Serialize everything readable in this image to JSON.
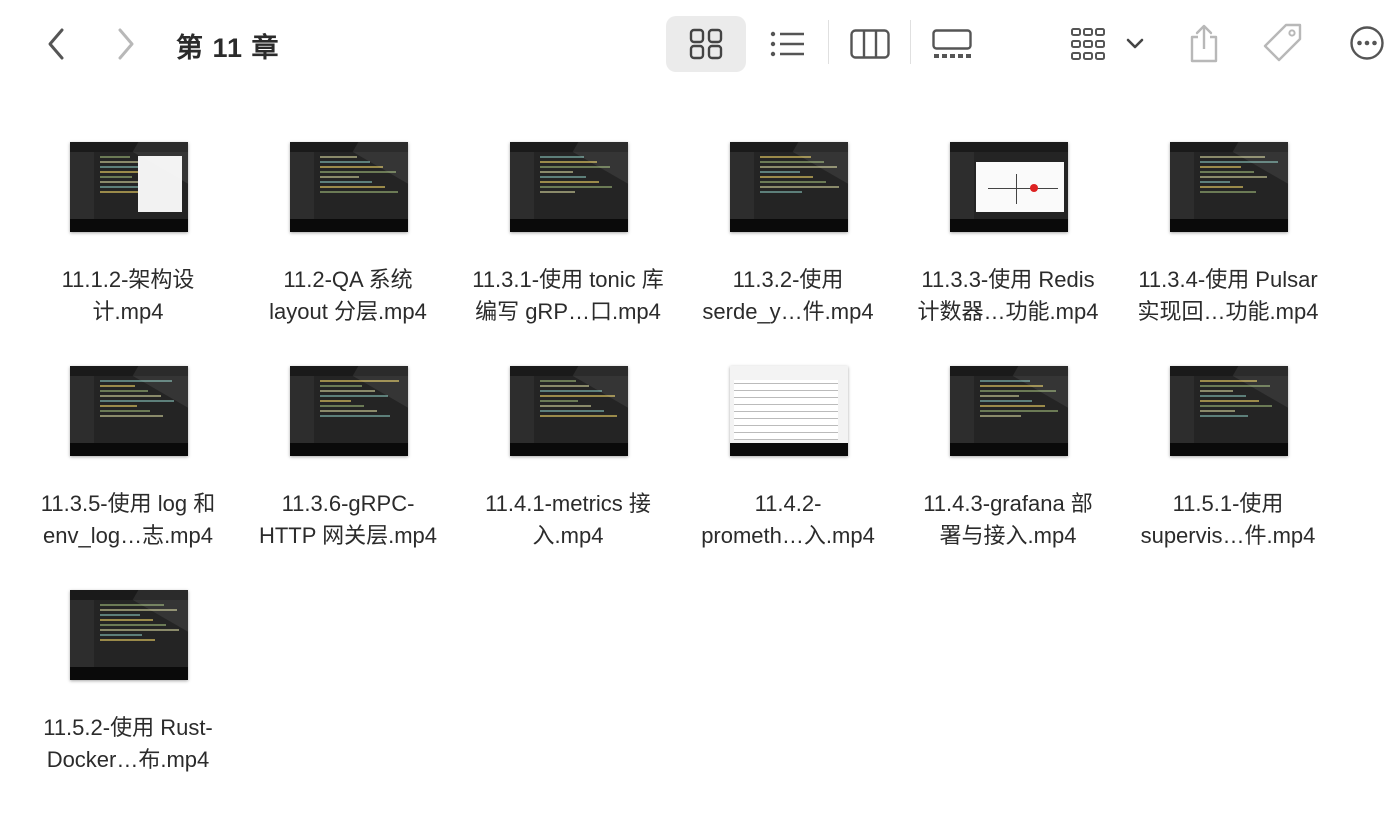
{
  "window": {
    "title": "第 11 章"
  },
  "toolbar": {
    "back": "chevron-left-icon",
    "forward": "chevron-right-icon",
    "views": [
      "icon-view",
      "list-view",
      "column-view",
      "gallery-view"
    ],
    "group": "group-icon",
    "share": "share-icon",
    "tags": "tag-icon",
    "more": "ellipsis-icon"
  },
  "files": [
    {
      "line1": "11.1.2-架构设",
      "line2": "计.mp4",
      "thumb": "code-panel"
    },
    {
      "line1": "11.2-QA 系统",
      "line2": "layout 分层.mp4",
      "thumb": "code"
    },
    {
      "line1": "11.3.1-使用 tonic 库",
      "line2": "编写 gRP…口.mp4",
      "thumb": "code"
    },
    {
      "line1": "11.3.2-使用",
      "line2": "serde_y…件.mp4",
      "thumb": "code"
    },
    {
      "line1": "11.3.3-使用 Redis",
      "line2": "计数器…功能.mp4",
      "thumb": "diagram"
    },
    {
      "line1": "11.3.4-使用 Pulsar",
      "line2": "实现回…功能.mp4",
      "thumb": "code"
    },
    {
      "line1": "11.3.5-使用 log 和",
      "line2": "env_log…志.mp4",
      "thumb": "code"
    },
    {
      "line1": "11.3.6-gRPC-",
      "line2": "HTTP 网关层.mp4",
      "thumb": "code"
    },
    {
      "line1": "11.4.1-metrics 接",
      "line2": "入.mp4",
      "thumb": "code"
    },
    {
      "line1": "11.4.2-",
      "line2": "prometh…入.mp4",
      "thumb": "light"
    },
    {
      "line1": "11.4.3-grafana 部",
      "line2": "署与接入.mp4",
      "thumb": "code"
    },
    {
      "line1": "11.5.1-使用",
      "line2": "supervis…件.mp4",
      "thumb": "code"
    },
    {
      "line1": "11.5.2-使用 Rust-",
      "line2": "Docker…布.mp4",
      "thumb": "code"
    }
  ]
}
